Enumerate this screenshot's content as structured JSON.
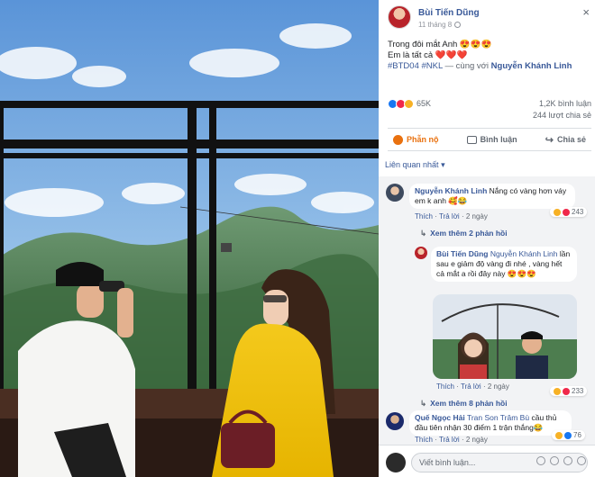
{
  "post": {
    "author": "Bùi Tiến Dũng",
    "date": "11 tháng 8",
    "line1": "Trong đôi mắt Anh",
    "line1_emoji": "😍😍😍",
    "line2": "Em là tất cả",
    "line2_emoji": "❤️❤️❤️",
    "hashtags": "#BTD04 #NKL",
    "with_text": " — cùng với ",
    "tagged": "Nguyễn Khánh Linh",
    "close_symbol": "×"
  },
  "stats": {
    "reactions": "65K",
    "comments": "1,2K bình luận",
    "shares": "244 lượt chia sẻ"
  },
  "actions": {
    "react_label": "Phẫn nộ",
    "comment_label": "Bình luận",
    "share_label": "Chia sẻ"
  },
  "sort": {
    "label": "Liên quan nhất",
    "caret": "▾"
  },
  "comments": [
    {
      "name": "Nguyễn Khánh Linh",
      "text": "Nắng có vàng hơn váy em k anh 🥰😂",
      "reply": "Thích",
      "reply_link": "Trả lời",
      "age": "2 ngày",
      "count": "243",
      "more": "Xem thêm 2 phản hồi"
    },
    {
      "name": "Bùi Tiến Dũng",
      "mention": "Nguyễn Khánh Linh",
      "text": "lần sau e giảm độ vàng đi nhé , vàng hết cả mắt a rồi đây này 😍😍😍",
      "reply": "Thích",
      "reply_link": "Trả lời",
      "age": "2 ngày",
      "count": "233",
      "more": "Xem thêm 8 phản hồi"
    },
    {
      "name": "Quế Ngọc Hải",
      "mention": "Tran Son Trâm Bù",
      "text": "cầu thủ đầu tiên nhận 30 điểm 1 trận thắng😂",
      "reply": "Thích",
      "reply_link": "Trả lời",
      "age": "2 ngày",
      "count": "76"
    }
  ],
  "composer": {
    "placeholder": "Viết bình luận..."
  },
  "colors": {
    "link": "#385898",
    "angry": "#e9710f",
    "like": "#1877f2",
    "love": "#f0284a",
    "haha": "#f7b125"
  }
}
